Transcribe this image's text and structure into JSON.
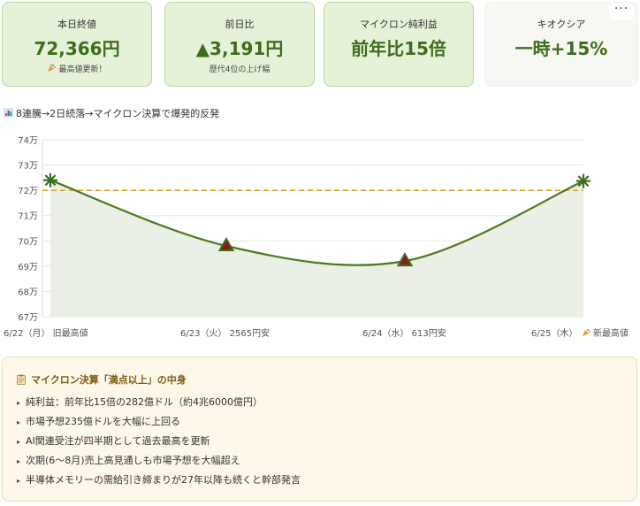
{
  "colors": {
    "accent": "#3d6e1b",
    "line": "#4a7a1e",
    "area": "#e9eee4",
    "reference": "#e0a32a",
    "marker_fill": "#8b1a1a",
    "card_bg": "#e6f2d8",
    "info_bg": "#fdf8e9"
  },
  "cards": [
    {
      "label": "本日終値",
      "value": "72,366円",
      "sub_icon": "party-popper-icon",
      "sub": "最高値更新！"
    },
    {
      "label": "前日比",
      "value": "▲3,191円",
      "sub": "歴代4位の上げ幅"
    },
    {
      "label": "マイクロン純利益",
      "value": "前年比15倍"
    },
    {
      "label": "キオクシア",
      "value": "一時+15%"
    }
  ],
  "more_button": "···",
  "chart_data": {
    "type": "line",
    "title": "8連騰→2日続落→マイクロン決算で爆発的反発",
    "title_icon": "bar-chart-icon",
    "categories": [
      "6/22（月） 旧最高値",
      "6/23（火） 2565円安",
      "6/24（水） 613円安",
      "6/25（木） 新最高値"
    ],
    "category_icons": [
      null,
      null,
      null,
      "party-popper-icon"
    ],
    "values": [
      72400,
      69800,
      69200,
      72366
    ],
    "marker_types": [
      "star",
      "triangle",
      "triangle",
      "star"
    ],
    "reference_line": 72000,
    "y_ticks": [
      "67万",
      "68万",
      "69万",
      "70万",
      "71万",
      "72万",
      "73万",
      "74万"
    ],
    "y_tick_values": [
      67000,
      68000,
      69000,
      70000,
      71000,
      72000,
      73000,
      74000
    ],
    "ylim": [
      67000,
      74000
    ],
    "grid": true,
    "xlabel": "",
    "ylabel": ""
  },
  "info": {
    "title_icon": "clipboard-icon",
    "title": "マイクロン決算「満点以上」の中身",
    "items": [
      "純利益：前年比15倍の282億ドル（約4兆6000億円）",
      "市場予想235億ドルを大幅に上回る",
      "AI関連受注が四半期として過去最高を更新",
      "次期(6〜8月)売上高見通しも市場予想を大幅超え",
      "半導体メモリーの需給引き締まりが27年以降も続くと幹部発言"
    ]
  }
}
